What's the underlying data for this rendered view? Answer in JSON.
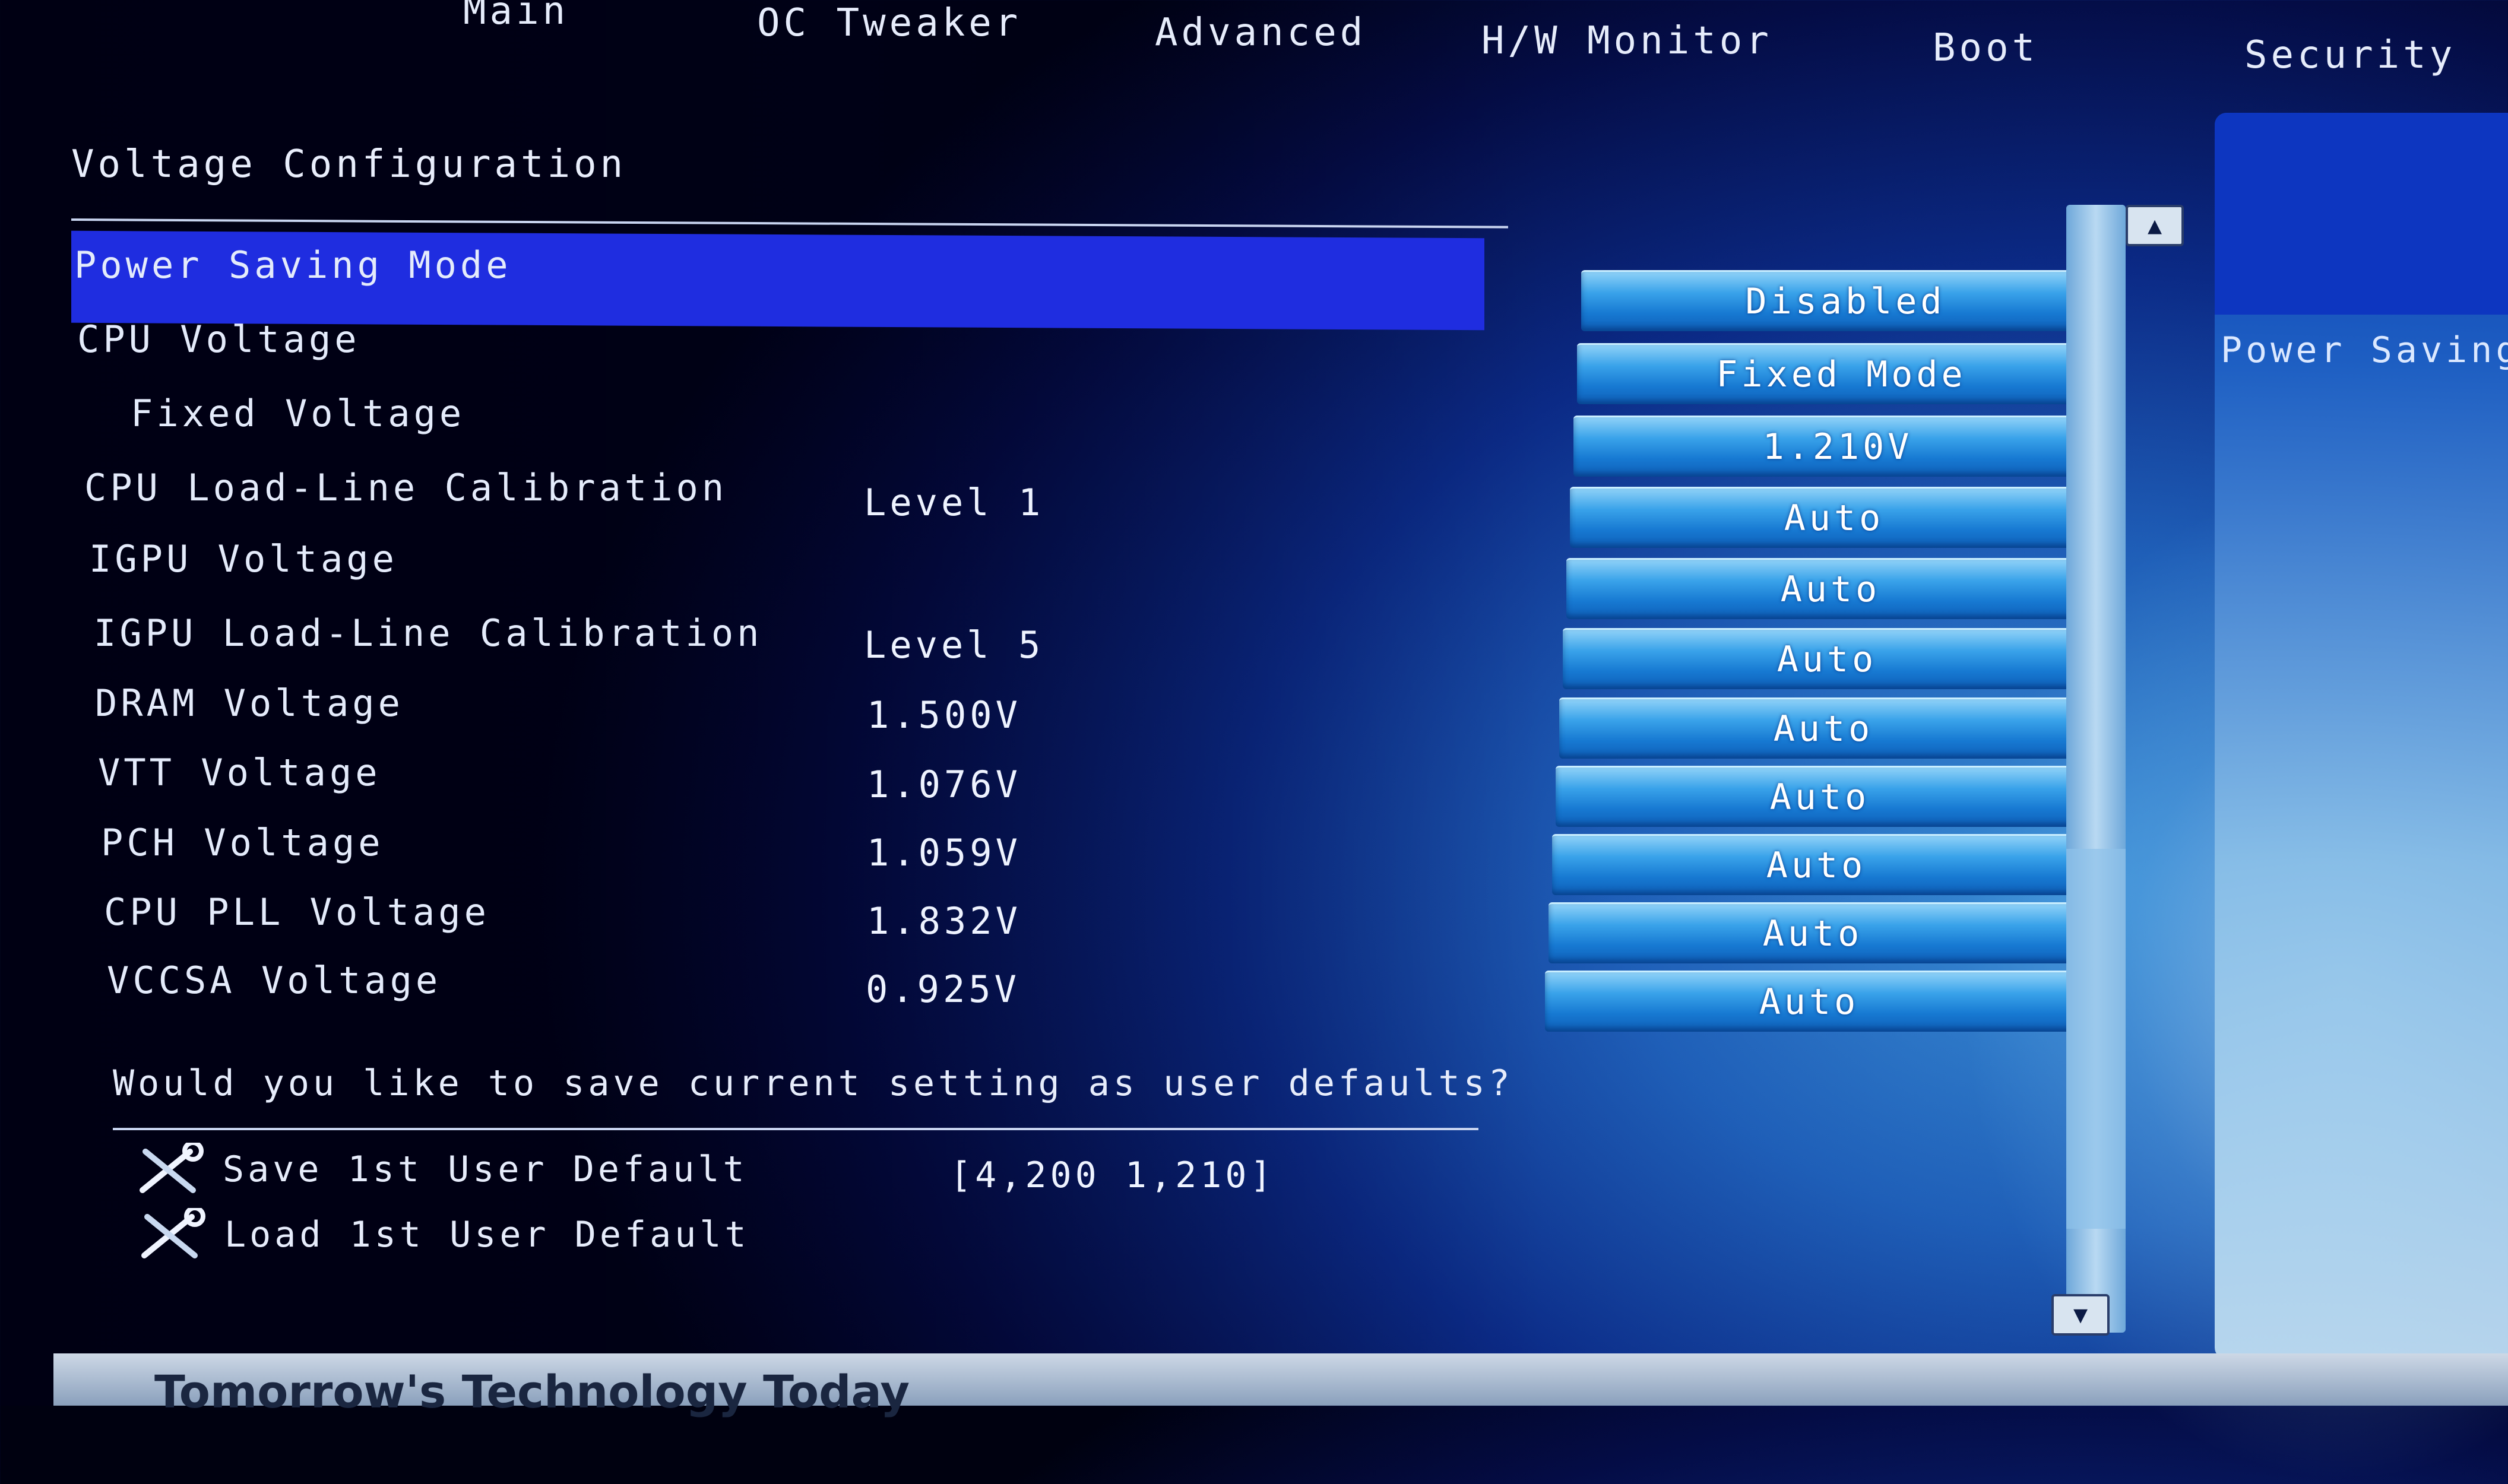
{
  "tabs": [
    "Main",
    "OC Tweaker",
    "Advanced",
    "H/W Monitor",
    "Boot",
    "Security"
  ],
  "section_title": "Voltage Configuration",
  "rows": [
    {
      "label": "Power Saving Mode",
      "value": "",
      "option": "Disabled"
    },
    {
      "label": "CPU Voltage",
      "value": "",
      "option": "Fixed Mode"
    },
    {
      "label": "Fixed Voltage",
      "value": "",
      "option": "1.210V"
    },
    {
      "label": "CPU Load-Line Calibration",
      "value": "Level 1",
      "option": "Auto"
    },
    {
      "label": "IGPU Voltage",
      "value": "",
      "option": "Auto"
    },
    {
      "label": "IGPU Load-Line Calibration",
      "value": "Level 5",
      "option": "Auto"
    },
    {
      "label": "DRAM Voltage",
      "value": "1.500V",
      "option": "Auto"
    },
    {
      "label": "VTT Voltage",
      "value": "1.076V",
      "option": "Auto"
    },
    {
      "label": "PCH Voltage",
      "value": "1.059V",
      "option": "Auto"
    },
    {
      "label": "CPU PLL Voltage",
      "value": "1.832V",
      "option": "Auto"
    },
    {
      "label": "VCCSA Voltage",
      "value": "0.925V",
      "option": "Auto"
    }
  ],
  "help_text": "Power Saving",
  "save_prompt": "Would you like to save current setting as user defaults?",
  "user_defaults": [
    {
      "label": "Save 1st User Default",
      "value": "[4,200 1,210]",
      "icon": "wrench-screwdriver-icon"
    },
    {
      "label": "Load 1st User Default",
      "value": "",
      "icon": "wrench-screwdriver-icon"
    }
  ],
  "footer_slogan": "Tomorrow's Technology Today",
  "colors": {
    "highlight": "#1f2de0",
    "background": "#0b2a86",
    "option_button": "#1779d2"
  }
}
